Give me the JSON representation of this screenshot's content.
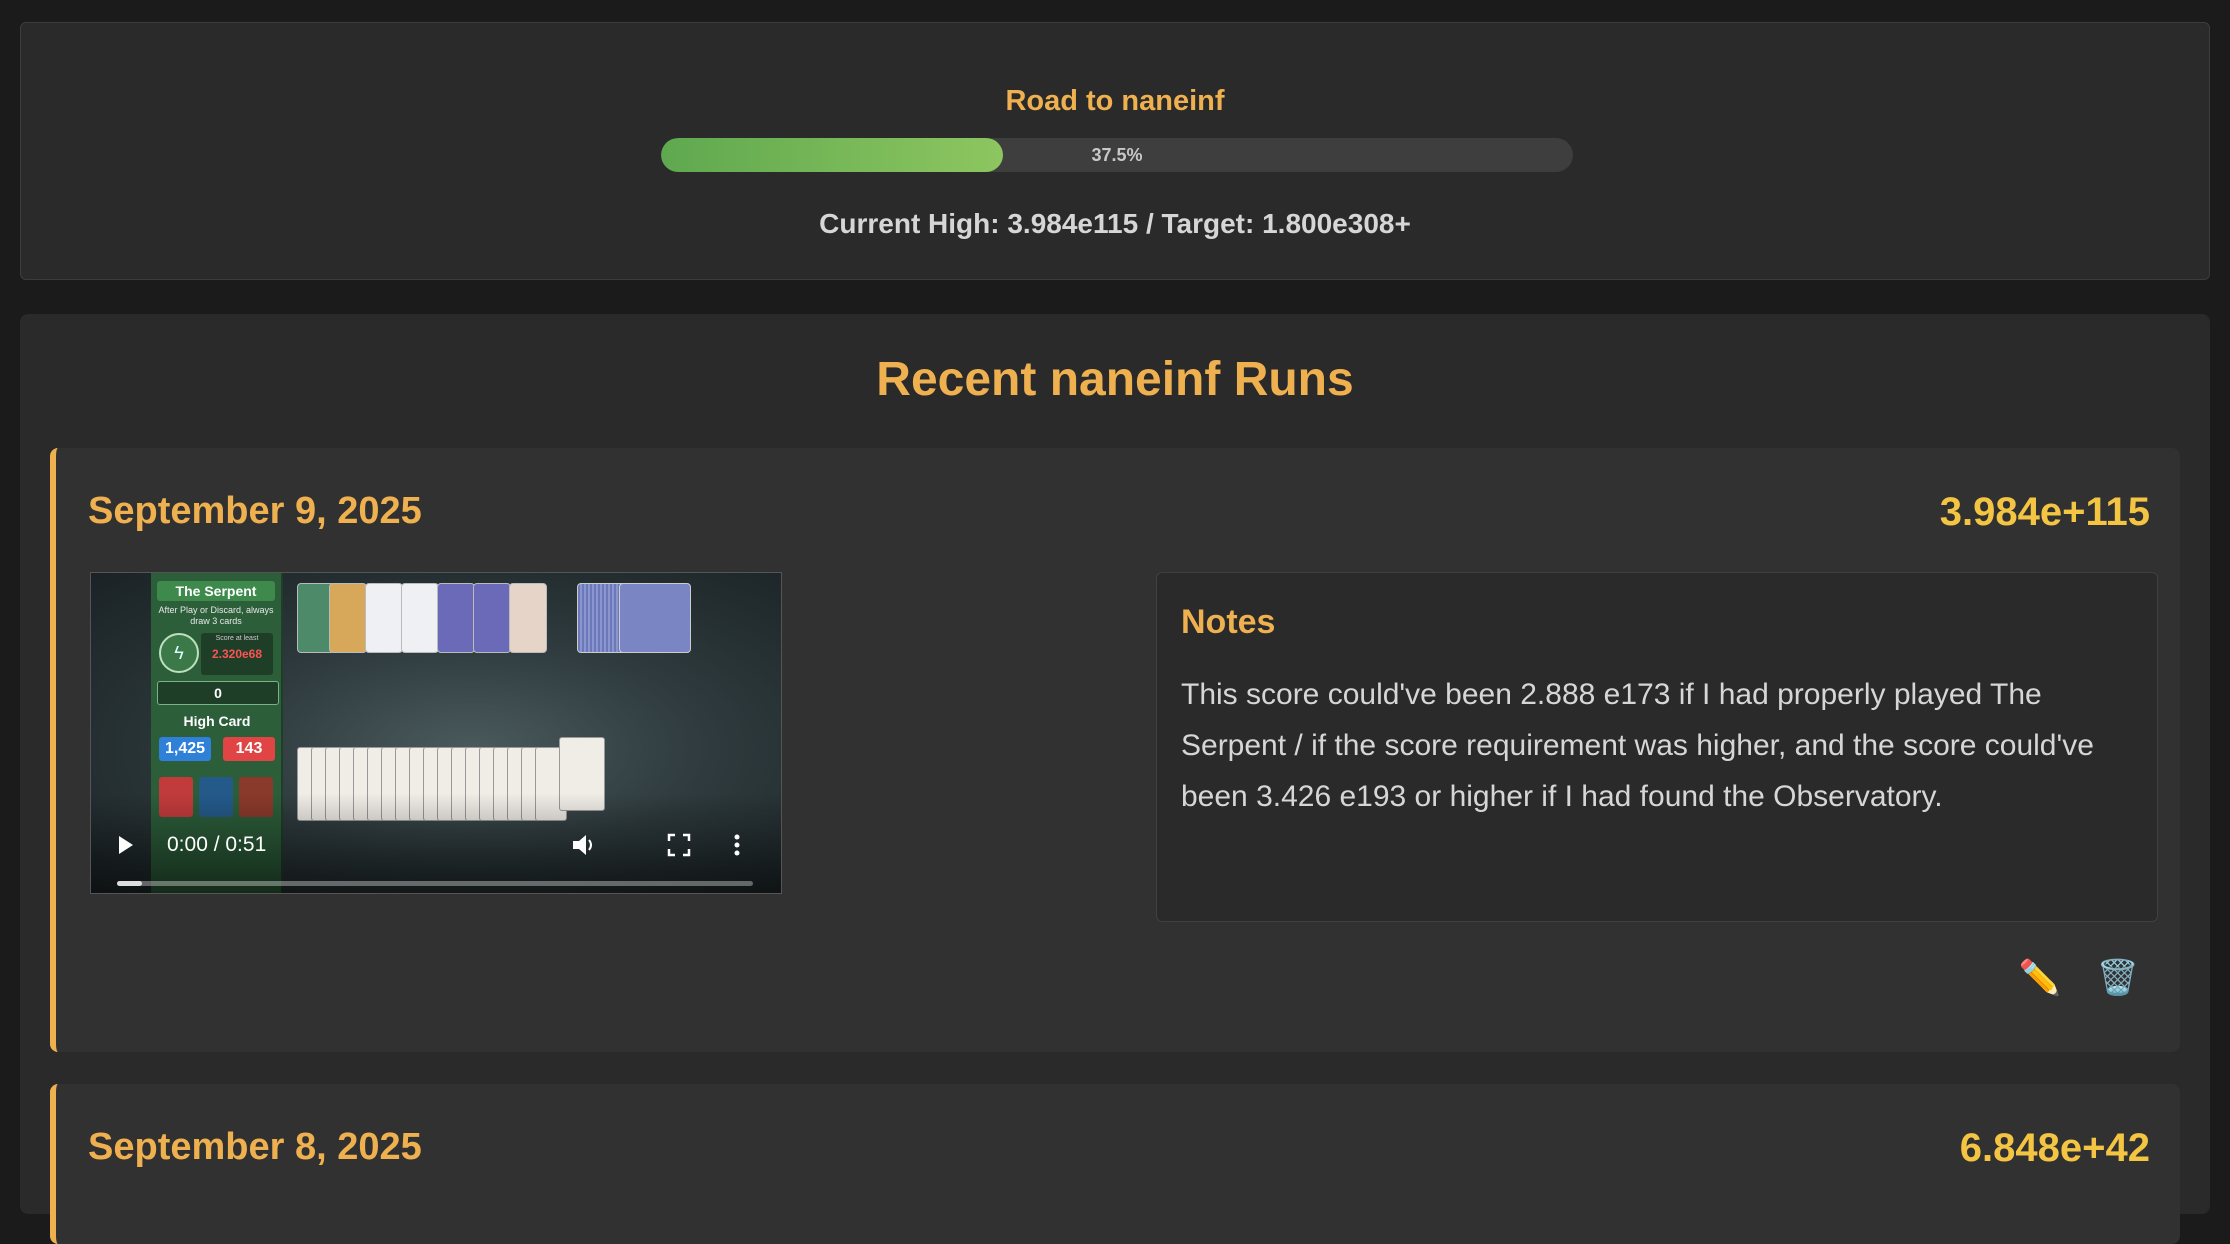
{
  "progress": {
    "title": "Road to naneinf",
    "percent_label": "37.5%",
    "percent_value": 37.5,
    "status": "Current High: 3.984e115 / Target: 1.800e308+"
  },
  "runs_section": {
    "heading": "Recent naneinf Runs"
  },
  "runs": [
    {
      "date": "September 9, 2025",
      "score": "3.984e+115",
      "video": {
        "current_time": "0:00 / 0:51",
        "progress_fraction": 0.04,
        "game": {
          "blind_name": "The Serpent",
          "blind_desc": "After Play or Discard, always draw 3 cards",
          "score_at_least_label": "Score at least",
          "score_at_least_value": "2.320e68",
          "round_score": "0",
          "hand_name": "High Card",
          "chips": "1,425",
          "mult": "143"
        }
      },
      "notes_heading": "Notes",
      "notes_text": "This score could've been 2.888 e173 if I had properly played The Serpent / if the score requirement was higher, and the score could've been 3.426 e193 or higher if I had found the Observatory.",
      "edit_icon": "pencil-icon",
      "delete_icon": "trash-icon"
    },
    {
      "date": "September 8, 2025",
      "score": "6.848e+42"
    }
  ],
  "colors": {
    "accent": "#efb04f",
    "score": "#f4c542",
    "progress_fill": "#7ab85a",
    "background": "#1b1b1b",
    "card": "#2a2a2a"
  }
}
